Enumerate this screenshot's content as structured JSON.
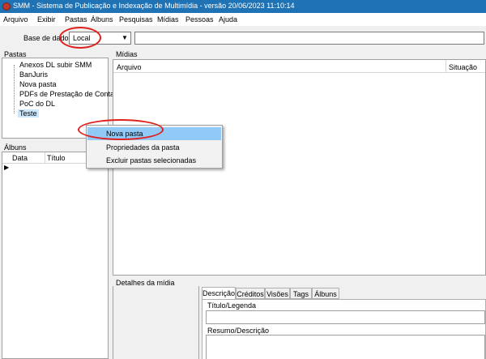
{
  "window": {
    "title": "SMM - Sistema de Publicação e Indexação de Multimídia - versão 20/06/2023 11:10:14"
  },
  "menu": [
    "Arquivo",
    "Exibir",
    "Pastas",
    "Álbuns",
    "Pesquisas",
    "Mídias",
    "Pessoas",
    "Ajuda"
  ],
  "toolbar": {
    "db_label": "Base de dados:",
    "db_value": "Local",
    "search_value": ""
  },
  "folders": {
    "title": "Pastas",
    "items": [
      "Anexos DL subir SMM",
      "BanJuris",
      "Nova pasta",
      "PDFs de Prestação de Contas",
      "PoC do DL",
      "Teste"
    ],
    "selected_index": 5
  },
  "albums": {
    "title": "Álbuns",
    "columns": [
      "Data",
      "Título"
    ]
  },
  "media": {
    "title": "Mídias",
    "columns": [
      "Arquivo",
      "Situação"
    ]
  },
  "details": {
    "title": "Detalhes da mídia",
    "tabs": [
      "Descrição",
      "Créditos",
      "Visões",
      "Tags",
      "Álbuns"
    ],
    "active_tab": 0,
    "fields": {
      "title_label": "Título/Legenda",
      "title_value": "",
      "summary_label": "Resumo/Descrição",
      "summary_value": ""
    }
  },
  "context_menu": {
    "items": [
      "Nova pasta",
      "Propriedades da pasta",
      "Excluir pastas selecionadas"
    ],
    "highlighted_index": 0
  },
  "colors": {
    "titlebar": "#1f73b5",
    "selection": "#91c9f7",
    "annotation": "#e0201c"
  }
}
